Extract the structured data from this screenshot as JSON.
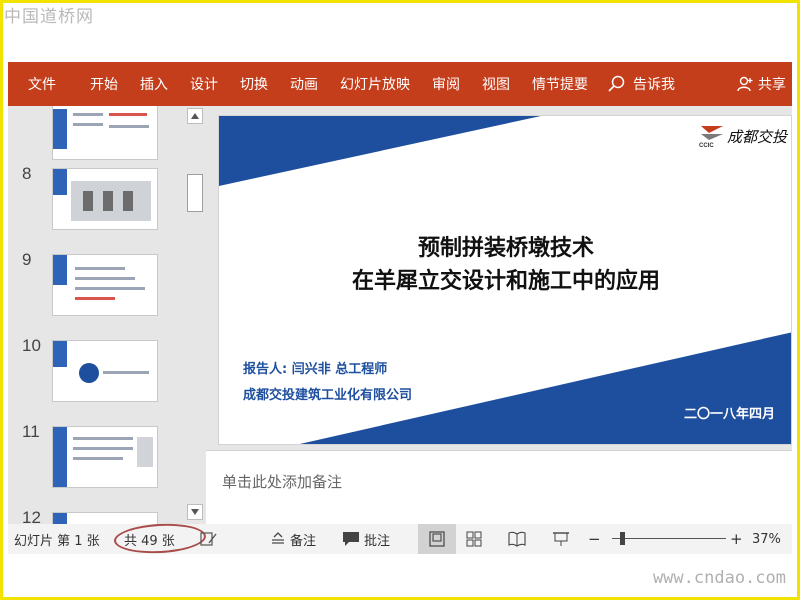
{
  "watermarks": {
    "top": "中国道桥网",
    "bottom": "www.cndao.com"
  },
  "ribbon": {
    "tabs": [
      "文件",
      "开始",
      "插入",
      "设计",
      "切换",
      "动画",
      "幻灯片放映",
      "审阅",
      "视图",
      "情节提要"
    ],
    "tell_me": "告诉我",
    "share": "共享"
  },
  "thumbnails": {
    "numbers": [
      "8",
      "9",
      "10",
      "11",
      "12"
    ]
  },
  "slide": {
    "title_line1": "预制拼装桥墩技术",
    "title_line2": "在羊犀立交设计和施工中的应用",
    "reporter": "报告人: 闫兴非  总工程师",
    "company": "成都交投建筑工业化有限公司",
    "date": "二〇一八年四月",
    "logo_abbr": "CCIC",
    "logo_text": "成都交投",
    "colors": {
      "accent": "#1e4f9e",
      "ribbon": "#c43e1c"
    }
  },
  "notes": {
    "placeholder": "单击此处添加备注"
  },
  "status": {
    "slide_of": "幻灯片 第 1 张",
    "total": "共 49 张",
    "notes_label": "备注",
    "comments_label": "批注",
    "zoom": "37%",
    "minus": "−",
    "plus": "+"
  }
}
